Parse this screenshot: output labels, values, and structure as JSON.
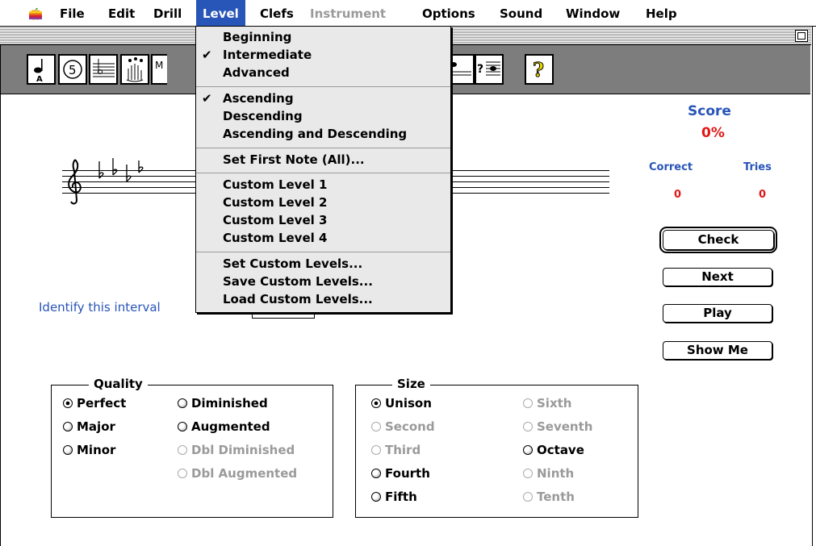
{
  "menubar": {
    "items": [
      {
        "label": "File",
        "state": "normal"
      },
      {
        "label": "Edit",
        "state": "normal"
      },
      {
        "label": "Drill",
        "state": "normal"
      },
      {
        "label": "Level",
        "state": "active"
      },
      {
        "label": "Clefs",
        "state": "normal"
      },
      {
        "label": "Instrument",
        "state": "disabled"
      },
      {
        "label": "Options",
        "state": "normal"
      },
      {
        "label": "Sound",
        "state": "normal"
      },
      {
        "label": "Window",
        "state": "normal"
      },
      {
        "label": "Help",
        "state": "normal"
      }
    ]
  },
  "toolbar": {
    "icons": [
      "note-a-icon",
      "circle-5-icon",
      "staff-flat-icon",
      "hand-notes-icon",
      "metronome-icon",
      "staff-icon",
      "bass-clef-staff-icon",
      "help-question-icon"
    ],
    "labels": {
      "note": "A",
      "circle": "5",
      "help": "?"
    }
  },
  "level_menu": {
    "sections": [
      [
        {
          "label": "Beginning",
          "checked": false
        },
        {
          "label": "Intermediate",
          "checked": true
        },
        {
          "label": "Advanced",
          "checked": false
        }
      ],
      [
        {
          "label": "Ascending",
          "checked": true
        },
        {
          "label": "Descending",
          "checked": false
        },
        {
          "label": "Ascending and Descending",
          "checked": false
        }
      ],
      [
        {
          "label": "Set First Note (All)...",
          "checked": false
        }
      ],
      [
        {
          "label": "Custom Level  1",
          "checked": false
        },
        {
          "label": "Custom Level  2",
          "checked": false
        },
        {
          "label": "Custom Level  3",
          "checked": false
        },
        {
          "label": "Custom Level  4",
          "checked": false
        }
      ],
      [
        {
          "label": "Set Custom Levels...",
          "checked": false
        },
        {
          "label": "Save Custom Levels...",
          "checked": false
        },
        {
          "label": "Load Custom Levels...",
          "checked": false
        }
      ]
    ],
    "check_glyph": "✔"
  },
  "score": {
    "title": "Score",
    "percent": "0%",
    "correct_label": "Correct",
    "tries_label": "Tries",
    "correct_value": "0",
    "tries_value": "0"
  },
  "buttons": {
    "check": "Check",
    "next": "Next",
    "play": "Play",
    "show_me": "Show Me"
  },
  "prompt": "Identify this interval",
  "quality": {
    "title": "Quality",
    "options": [
      {
        "label": "Perfect",
        "state": "checked"
      },
      {
        "label": "Diminished",
        "state": "enabled"
      },
      {
        "label": "Major",
        "state": "enabled"
      },
      {
        "label": "Augmented",
        "state": "enabled"
      },
      {
        "label": "Minor",
        "state": "enabled"
      },
      {
        "label": "Dbl Diminished",
        "state": "disabled"
      },
      {
        "label": "Dbl Augmented",
        "state": "disabled"
      }
    ]
  },
  "size": {
    "title": "Size",
    "options": [
      {
        "label": "Unison",
        "state": "checked"
      },
      {
        "label": "Sixth",
        "state": "disabled"
      },
      {
        "label": "Second",
        "state": "disabled"
      },
      {
        "label": "Seventh",
        "state": "disabled"
      },
      {
        "label": "Third",
        "state": "disabled"
      },
      {
        "label": "Octave",
        "state": "enabled"
      },
      {
        "label": "Fourth",
        "state": "enabled"
      },
      {
        "label": "Ninth",
        "state": "disabled"
      },
      {
        "label": "Fifth",
        "state": "enabled"
      },
      {
        "label": "Tenth",
        "state": "disabled"
      }
    ]
  },
  "colors": {
    "accent": "#2855b8",
    "score_red": "#e01818",
    "disabled": "#9a9a9a",
    "toolbar": "#7d7d7d"
  }
}
